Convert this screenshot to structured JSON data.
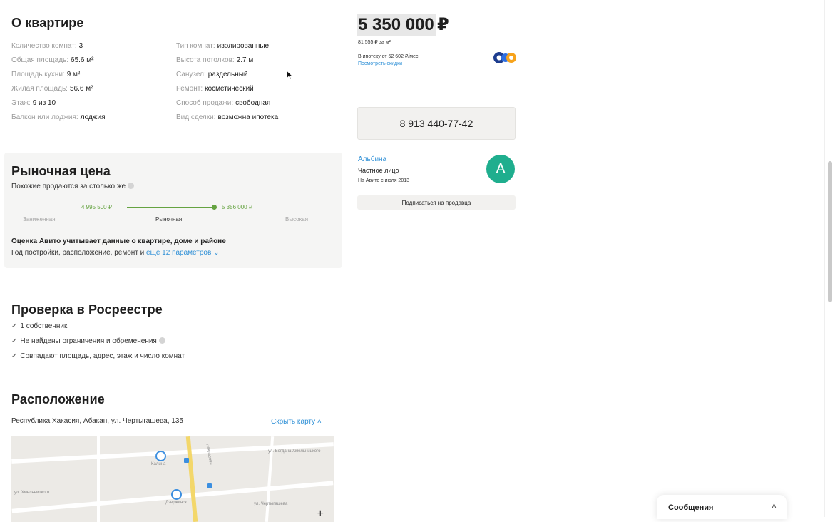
{
  "about": {
    "title": "О квартире",
    "left_params": [
      {
        "label": "Количество комнат:",
        "value": "3"
      },
      {
        "label": "Общая площадь:",
        "value": "65.6 м²"
      },
      {
        "label": "Площадь кухни:",
        "value": "9 м²"
      },
      {
        "label": "Жилая площадь:",
        "value": "56.6 м²"
      },
      {
        "label": "Этаж:",
        "value": "9 из 10"
      },
      {
        "label": "Балкон или лоджия:",
        "value": "лоджия"
      }
    ],
    "right_params": [
      {
        "label": "Тип комнат:",
        "value": "изолированные"
      },
      {
        "label": "Высота потолков:",
        "value": "2.7 м"
      },
      {
        "label": "Санузел:",
        "value": "раздельный"
      },
      {
        "label": "Ремонт:",
        "value": "косметический"
      },
      {
        "label": "Способ продажи:",
        "value": "свободная"
      },
      {
        "label": "Вид сделки:",
        "value": "возможна ипотека"
      }
    ]
  },
  "market": {
    "title": "Рыночная цена",
    "subtitle": "Похожие продаются за столько же",
    "range_low": "4 995 500 ₽",
    "range_high": "5 356 000 ₽",
    "cap_low": "Заниженная",
    "cap_mid": "Рыночная",
    "cap_high": "Высокая",
    "note_bold": "Оценка Авито учитывает данные о квартире, доме и районе",
    "note_text": "Год постройки, расположение, ремонт и ",
    "note_link": "ещё 12 параметров ⌄"
  },
  "rosreestr": {
    "title": "Проверка в Росреестре",
    "items": [
      "1 собственник",
      "Не найдены ограничения и обременения",
      "Совпадают площадь, адрес, этаж и число комнат"
    ]
  },
  "location": {
    "title": "Расположение",
    "address": "Республика Хакасия, Абакан, ул. Чертыгашева, 135",
    "hide_map": "Скрыть карту ˄",
    "map_labels": [
      "ул. Богдана Хмельницкого",
      "ул. Хмельницкого",
      "ул. Чертыгашева",
      "Калина",
      "Дзержинск",
      "Некрасова"
    ],
    "zoom_in": "+"
  },
  "price": {
    "amount": "5 350 000",
    "currency": "₽",
    "per_m2": "81 555 ₽ за м²",
    "mortgage": "В ипотеку от 52 602 ₽/мес.",
    "discounts_link": "Посмотреть скидки"
  },
  "contact": {
    "phone": "8 913 440-77-42"
  },
  "seller": {
    "name": "Альбина",
    "type": "Частное лицо",
    "since": "На Авито с июля 2013",
    "avatar_letter": "А",
    "subscribe": "Подписаться на продавца"
  },
  "messages": {
    "label": "Сообщения",
    "chevron": "˄"
  },
  "colors": {
    "accent_green": "#65a341",
    "link_blue": "#2d8fd6",
    "avatar_teal": "#1fae8e"
  }
}
